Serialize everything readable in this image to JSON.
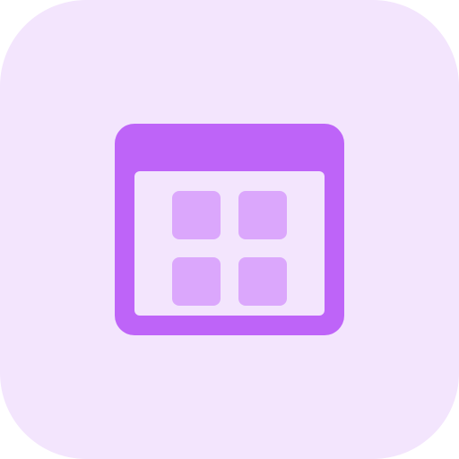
{
  "icon": {
    "name": "app-grid-window-icon",
    "colors": {
      "tile_background": "#F3E5FD",
      "window_frame": "#BE64F8",
      "window_body": "#F3E5FD",
      "grid_cells": "#DBA7FC"
    }
  }
}
